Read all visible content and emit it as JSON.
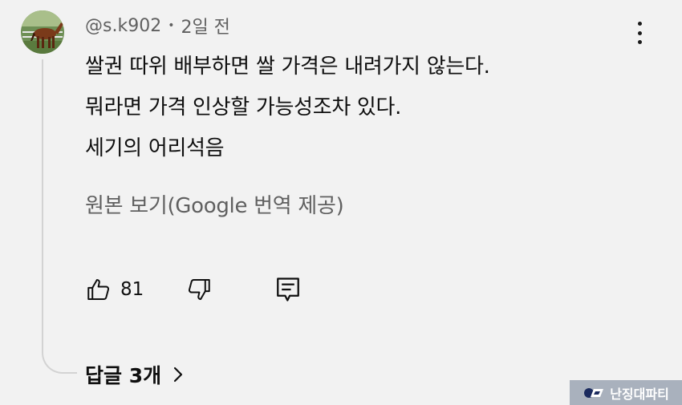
{
  "comment": {
    "author": "@s.k902",
    "separator": "•",
    "timestamp": "2일 전",
    "lines": [
      "쌀권 따위 배부하면 쌀 가격은 내려가지 않는다.",
      "뭐라면 가격 인상할 가능성조차 있다.",
      "세기의 어리석음"
    ],
    "translate_link": "원본 보기(Google 번역 제공)",
    "like_count": "81",
    "replies_label": "답글 3개"
  },
  "watermark": {
    "text": "난징대파티"
  },
  "icons": {
    "avatar": "avatar-horse-image",
    "menu": "more-vert-icon",
    "like": "thumb-up-icon",
    "dislike": "thumb-down-icon",
    "reply": "comment-icon",
    "replies_chevron": "chevron-right-icon"
  }
}
